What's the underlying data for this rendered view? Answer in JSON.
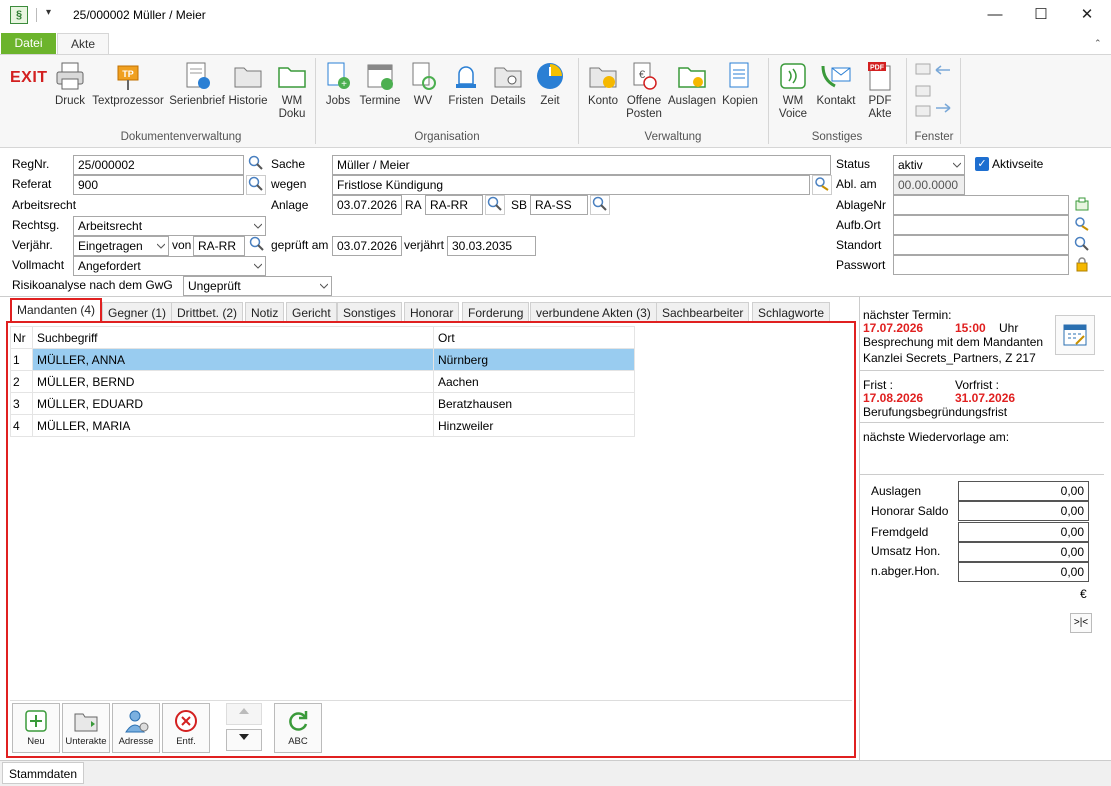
{
  "window": {
    "title": "25/000002 Müller / Meier",
    "app_icon": "§",
    "qa": "▾",
    "minimize": "—",
    "maximize": "☐",
    "close": "✕"
  },
  "ribbon": {
    "tabs": [
      "Datei",
      "Akte"
    ],
    "exit": "EXIT",
    "buttons": {
      "druck": "Druck",
      "textprozessor": "Textprozessor",
      "serienbrief": "Serienbrief",
      "historie": "Historie",
      "wmdoku1": "WM",
      "wmdoku2": "Doku",
      "jobs": "Jobs",
      "termine": "Termine",
      "wv": "WV",
      "fristen": "Fristen",
      "details": "Details",
      "zeit": "Zeit",
      "konto": "Konto",
      "offene1": "Offene",
      "offene2": "Posten",
      "auslagen": "Auslagen",
      "kopien": "Kopien",
      "wmvoice1": "WM",
      "wmvoice2": "Voice",
      "kontakt": "Kontakt",
      "pdfakte1": "PDF",
      "pdfakte2": "Akte"
    },
    "groups": {
      "dok": "Dokumentenverwaltung",
      "org": "Organisation",
      "verw": "Verwaltung",
      "sonst": "Sonstiges",
      "fenster": "Fenster"
    }
  },
  "form": {
    "regnr_label": "RegNr.",
    "regnr": "25/000002",
    "referat_label": "Referat",
    "referat": "900",
    "arbeitsrecht": "Arbeitsrecht",
    "rechtsg_label": "Rechtsg.",
    "rechtsg": "Arbeitsrecht",
    "verjaehr_label": "Verjähr.",
    "verjaehr": "Eingetragen",
    "von_label": "von",
    "von": "RA-RR",
    "geprueft_label": "geprüft am",
    "geprueft": "03.07.2026",
    "verjaehrt_label": "verjährt",
    "verjaehrt": "30.03.2035",
    "vollmacht_label": "Vollmacht",
    "vollmacht": "Angefordert",
    "gwg_label": "Risikoanalyse nach dem GwG",
    "gwg": "Ungeprüft",
    "sache_label": "Sache",
    "sache": "Müller / Meier",
    "wegen_label": "wegen",
    "wegen": "Fristlose Kündigung",
    "anlage_label": "Anlage",
    "anlage": "03.07.2026",
    "ra_label": "RA",
    "ra": "RA-RR",
    "sb_label": "SB",
    "sb": "RA-SS",
    "status_label": "Status",
    "status": "aktiv",
    "aktivseite": "Aktivseite",
    "ablam_label": "Abl. am",
    "ablam": "00.00.0000",
    "ablagenr_label": "AblageNr",
    "aufbort_label": "Aufb.Ort",
    "standort_label": "Standort",
    "passwort_label": "Passwort"
  },
  "tabs": [
    "Mandanten (4)",
    "Gegner (1)",
    "Drittbet. (2)",
    "Notiz",
    "Gericht",
    "Sonstiges",
    "Honorar",
    "Forderung",
    "verbundene Akten (3)",
    "Sachbearbeiter",
    "Schlagworte"
  ],
  "table": {
    "headers": [
      "Nr",
      "Suchbegriff",
      "Ort"
    ],
    "rows": [
      {
        "nr": "1",
        "name": "MÜLLER, ANNA",
        "ort": "Nürnberg"
      },
      {
        "nr": "2",
        "name": "MÜLLER, BERND",
        "ort": "Aachen"
      },
      {
        "nr": "3",
        "name": "MÜLLER, EDUARD",
        "ort": "Beratzhausen"
      },
      {
        "nr": "4",
        "name": "MÜLLER, MARIA",
        "ort": "Hinzweiler"
      }
    ]
  },
  "bottom_buttons": {
    "neu": "Neu",
    "unterakte": "Unterakte",
    "adresse": "Adresse",
    "entf": "Entf.",
    "abc": "ABC"
  },
  "right": {
    "termin_label": "nächster Termin:",
    "termin_date": "17.07.2026",
    "termin_time": "15:00",
    "uhr": "Uhr",
    "termin_desc": "Besprechung mit dem Mandanten",
    "termin_loc": "Kanzlei Secrets_Partners, Z 217",
    "frist_label": "Frist :",
    "vorfrist_label": "Vorfrist :",
    "frist": "17.08.2026",
    "vorfrist": "31.07.2026",
    "frist_desc": "Berufungsbegründungsfrist",
    "wv_label": "nächste Wiedervorlage am:",
    "money": [
      {
        "label": "Auslagen",
        "value": "0,00"
      },
      {
        "label": "Honorar Saldo",
        "value": "0,00"
      },
      {
        "label": "Fremdgeld",
        "value": "0,00"
      },
      {
        "label": "Umsatz Hon.",
        "value": "0,00"
      },
      {
        "label": "n.abger.Hon.",
        "value": "0,00"
      }
    ],
    "currency": "€",
    "collapse": ">|<"
  },
  "status_tab": "Stammdaten",
  "colors": {
    "accent_green": "#6cb42c",
    "highlight_red": "#e02020",
    "selection_blue": "#99ccf0"
  }
}
